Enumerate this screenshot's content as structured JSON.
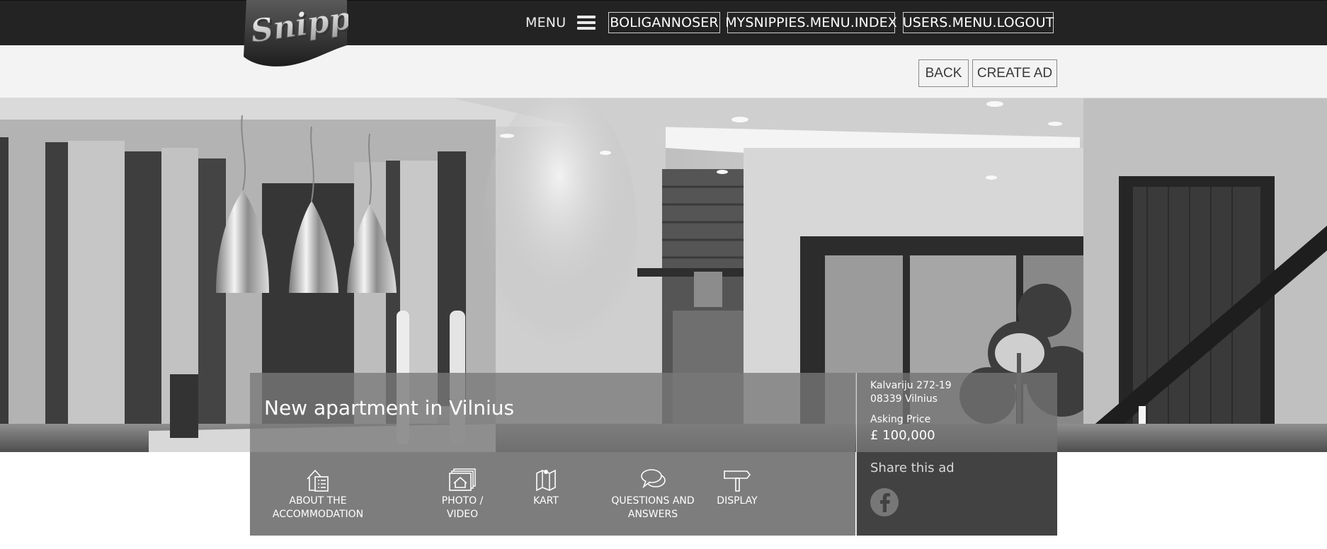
{
  "brand": {
    "logo_text": "Snippy"
  },
  "header": {
    "menu_label": "MENU",
    "nav": [
      {
        "label": "BOLIGANNOSER"
      },
      {
        "label": "MYSNIPPIES.MENU.INDEX"
      },
      {
        "label": "USERS.MENU.LOGOUT"
      }
    ]
  },
  "actions": {
    "back_label": "BACK",
    "create_label": "CREATE AD"
  },
  "ad": {
    "title": "New apartment in Vilnius",
    "address_line1": "Kalvariju 272-19",
    "address_line2": "08339 Vilnius",
    "price_label": "Asking Price",
    "price": "£ 100,000"
  },
  "tabs": [
    {
      "label": "ABOUT THE\nACCOMMODATION",
      "icon": "house-list-icon"
    },
    {
      "label": "PHOTO /\nVIDEO",
      "icon": "photo-gallery-icon"
    },
    {
      "label": "KART",
      "icon": "map-icon"
    },
    {
      "label": "QUESTIONS AND\nANSWERS",
      "icon": "chat-bubbles-icon"
    },
    {
      "label": "DISPLAY",
      "icon": "signpost-icon"
    }
  ],
  "share": {
    "title": "Share this ad",
    "networks": [
      "facebook-icon"
    ]
  },
  "colors": {
    "topbar": "#232323",
    "subbar": "#f3f3f3",
    "tabs_panel": "#7d7d7d",
    "share_panel": "#424242"
  }
}
